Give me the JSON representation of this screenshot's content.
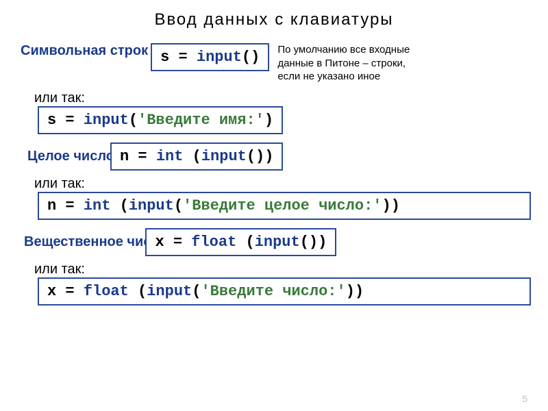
{
  "title": "Ввод данных с клавиатуры",
  "labels": {
    "string_type": "Символьная строк",
    "or_so_1": "или так:",
    "int_type": "Целое число",
    "or_so_2": "или так:",
    "float_type": "Вещественное чис",
    "or_so_3": "или так:"
  },
  "note": "По умолчанию все входные данные в Питоне – строки, если не указано иное",
  "code": {
    "c1_var": "s",
    "c1_eq": " = ",
    "c1_func": "input",
    "c1_paren": "()",
    "c2_var": "s",
    "c2_eq": " = ",
    "c2_func": "input",
    "c2_open": "(",
    "c2_str": "'Введите имя:'",
    "c2_close": ")",
    "c3_var": "n",
    "c3_eq": " = ",
    "c3_kw": "int",
    "c3_sp": " (",
    "c3_func": "input",
    "c3_close": "())",
    "c4_var": "n",
    "c4_eq": " = ",
    "c4_kw": "int",
    "c4_sp": " (",
    "c4_func": "input",
    "c4_open": "(",
    "c4_str": "'Введите целое число:'",
    "c4_close": "))",
    "c5_var": "x",
    "c5_eq": " = ",
    "c5_kw": "float",
    "c5_sp": " (",
    "c5_func": "input",
    "c5_close": "())",
    "c6_var": "x",
    "c6_eq": " = ",
    "c6_kw": "float",
    "c6_sp": " (",
    "c6_func": "input",
    "c6_open": "(",
    "c6_str": "'Введите число:'",
    "c6_close": "))"
  },
  "page_number": "5"
}
